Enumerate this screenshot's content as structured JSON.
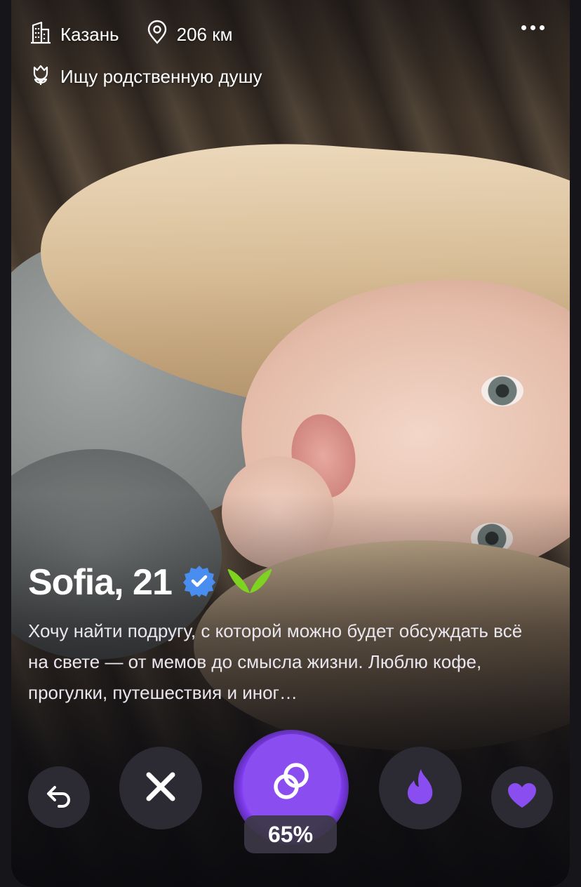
{
  "header": {
    "city": "Казань",
    "distance": "206 км",
    "goal": "Ищу родственную душу"
  },
  "profile": {
    "name_age": "Sofia, 21",
    "bio": "Хочу найти подругу, с которой можно будет обсуждать всё на свете — от мемов до смысла жизни. Люблю кофе, прогулки, путешествия и иног…"
  },
  "match": {
    "percent": "65%"
  },
  "colors": {
    "accent": "#8a4df0",
    "verified": "#4a8df0",
    "butterfly": "#7ed321",
    "button_bg": "#2c2a33"
  },
  "icons": {
    "city": "building-icon",
    "distance": "location-pin-icon",
    "goal": "flower-icon",
    "more": "more-dots-icon",
    "verified": "verified-badge-icon",
    "premium": "butterfly-icon",
    "undo": "undo-arrow-icon",
    "dislike": "close-icon",
    "match": "rings-icon",
    "superlike": "flame-icon",
    "like": "heart-icon"
  }
}
